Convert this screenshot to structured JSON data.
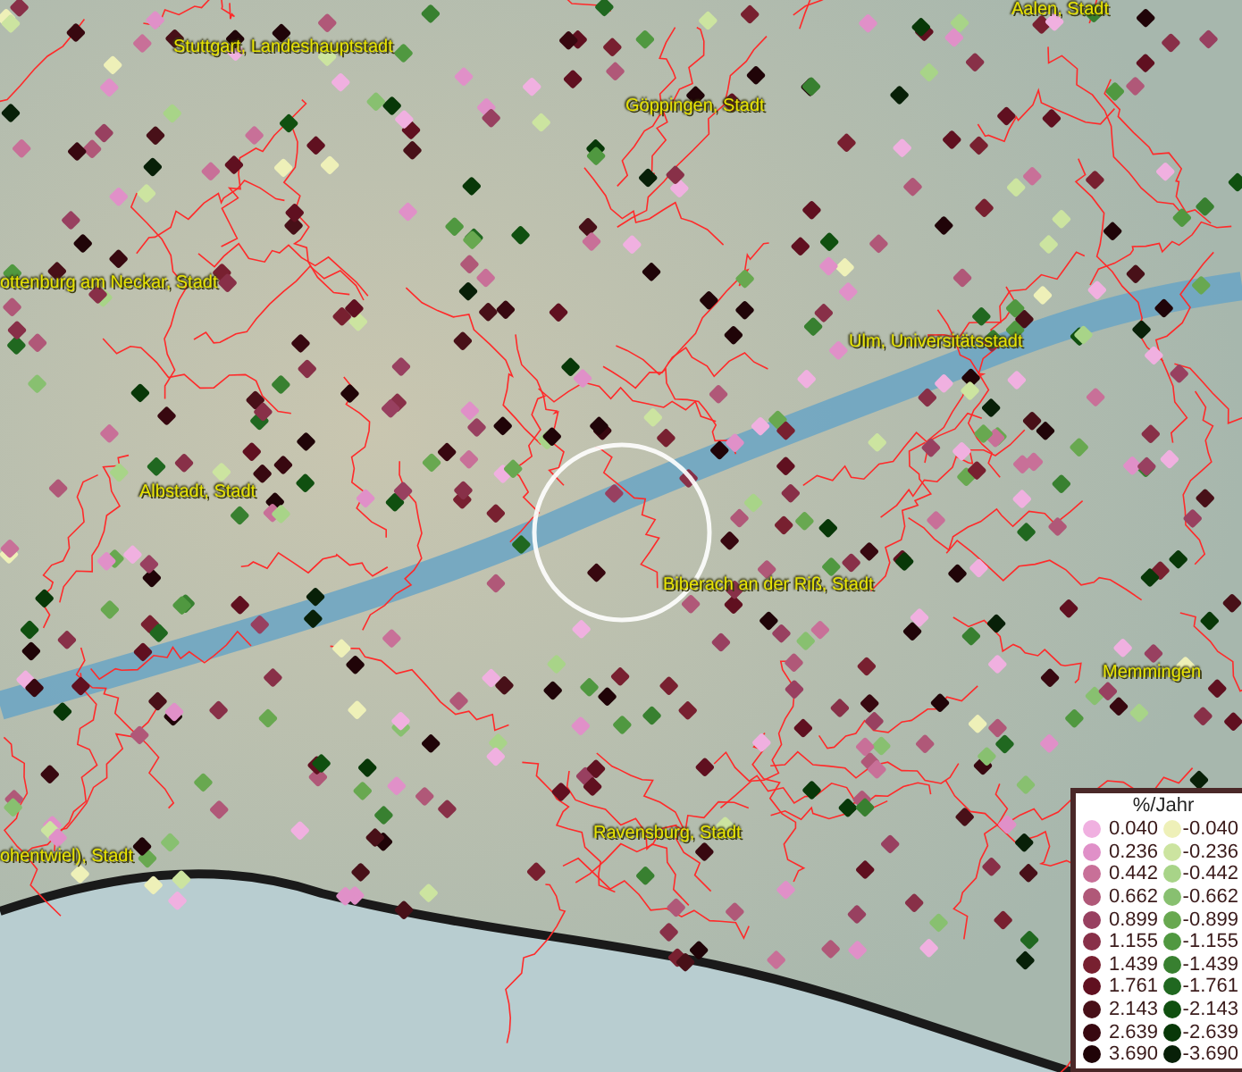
{
  "map": {
    "places": [
      {
        "name": "Aalen, Stadt"
      },
      {
        "name": "Stuttgart, Landeshauptstadt"
      },
      {
        "name": "Göppingen, Stadt"
      },
      {
        "name": "ottenburg am Neckar, Stadt"
      },
      {
        "name": "Ulm, Universitätsstadt"
      },
      {
        "name": "Albstadt, Stadt"
      },
      {
        "name": "Biberach an der Riß, Stadt"
      },
      {
        "name": "Memmingen"
      },
      {
        "name": "Ravensburg, Stadt"
      },
      {
        "name": "ohentwiel), Stadt"
      }
    ]
  },
  "legend": {
    "title": "%/Jahr",
    "rows": [
      {
        "positive": {
          "value": "0.040",
          "color": "#f0b0e0"
        },
        "negative": {
          "value": "-0.040",
          "color": "#eef0b8"
        }
      },
      {
        "positive": {
          "value": "0.236",
          "color": "#e090c8"
        },
        "negative": {
          "value": "-0.236",
          "color": "#cce4a0"
        }
      },
      {
        "positive": {
          "value": "0.442",
          "color": "#c87098"
        },
        "negative": {
          "value": "-0.442",
          "color": "#a8d488"
        }
      },
      {
        "positive": {
          "value": "0.662",
          "color": "#b05878"
        },
        "negative": {
          "value": "-0.662",
          "color": "#88c070"
        }
      },
      {
        "positive": {
          "value": "0.899",
          "color": "#984060"
        },
        "negative": {
          "value": "-0.899",
          "color": "#68a850"
        }
      },
      {
        "positive": {
          "value": "1.155",
          "color": "#883048"
        },
        "negative": {
          "value": "-1.155",
          "color": "#509840"
        }
      },
      {
        "positive": {
          "value": "1.439",
          "color": "#782030"
        },
        "negative": {
          "value": "-1.439",
          "color": "#388030"
        }
      },
      {
        "positive": {
          "value": "1.761",
          "color": "#601020"
        },
        "negative": {
          "value": "-1.761",
          "color": "#206820"
        }
      },
      {
        "positive": {
          "value": "2.143",
          "color": "#481018"
        },
        "negative": {
          "value": "-2.143",
          "color": "#105010"
        }
      },
      {
        "positive": {
          "value": "2.639",
          "color": "#380810"
        },
        "negative": {
          "value": "-2.639",
          "color": "#083808"
        }
      },
      {
        "positive": {
          "value": "3.690",
          "color": "#200408"
        },
        "negative": {
          "value": "-3.690",
          "color": "#082008"
        }
      }
    ]
  }
}
